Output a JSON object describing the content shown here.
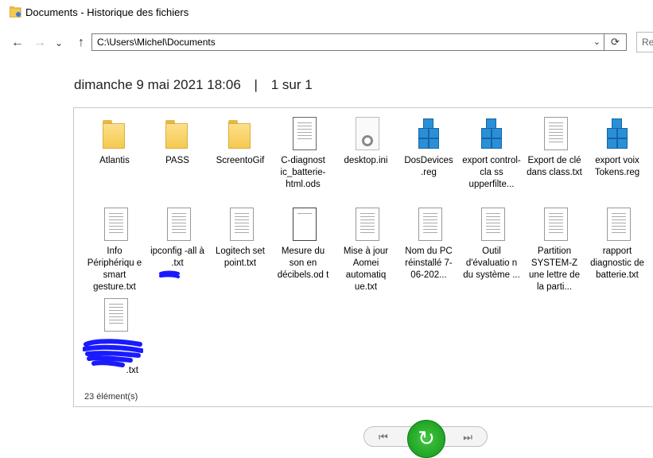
{
  "window": {
    "title": "Documents - Historique des fichiers"
  },
  "nav": {
    "back_icon": "arrow-left-icon",
    "forward_icon": "arrow-right-icon",
    "recent_icon": "chevron-down-icon",
    "up_icon": "arrow-up-icon",
    "back_glyph": "←",
    "forward_glyph": "→",
    "recent_glyph": "⌄",
    "up_glyph": "↑",
    "address": "C:\\Users\\Michel\\Documents",
    "dropdown_glyph": "⌄",
    "refresh_glyph": "⟳",
    "search_placeholder": "Re"
  },
  "header": {
    "date": "dimanche 9 mai 2021 18:06",
    "separator": "|",
    "page_info": "1 sur 1"
  },
  "items": [
    {
      "name": "Atlantis",
      "type": "folder"
    },
    {
      "name": "PASS",
      "type": "folder"
    },
    {
      "name": "ScreentoGif",
      "type": "folder"
    },
    {
      "name": "C-diagnostic_batterie-html.ods",
      "display": "C-diagnost ic_batterie- html.ods",
      "type": "ods"
    },
    {
      "name": "desktop.ini",
      "type": "ini"
    },
    {
      "name": "DosDevices.reg",
      "display": "DosDevices .reg",
      "type": "reg"
    },
    {
      "name": "export control-class upperfilte...",
      "display": "export control-cla ss upperfilte...",
      "type": "reg"
    },
    {
      "name": "Export de clé dans class.txt",
      "display": "Export de clé dans class.txt",
      "type": "txt"
    },
    {
      "name": "export voix Tokens.reg",
      "display": "export voix Tokens.reg",
      "type": "reg"
    },
    {
      "name": "Info Périphérique smart gesture.txt",
      "display": "Info Périphériqu e smart gesture.txt",
      "type": "txt"
    },
    {
      "name": "ipconfig-all à .txt",
      "display": "ipconfig -all à .txt",
      "type": "txt"
    },
    {
      "name": "Logitech set point.txt",
      "display": "Logitech set point.txt",
      "type": "txt"
    },
    {
      "name": "Mesure du son en décibels.odt",
      "display": "Mesure du son en décibels.od t",
      "type": "odt"
    },
    {
      "name": "Mise à jour Aomei automatique.txt",
      "display": "Mise à jour Aomei automatiq ue.txt",
      "type": "txt"
    },
    {
      "name": "Nom du PC réinstallé 7-06-202...",
      "display": "Nom du PC réinstallé 7-06-202...",
      "type": "txt"
    },
    {
      "name": "Outil d'évaluation du système ...",
      "display": "Outil d'évaluatio n du système ...",
      "type": "txt"
    },
    {
      "name": "Partition SYSTEM-Z une lettre de la parti...",
      "display": "Partition SYSTEM-Z une lettre de la parti...",
      "type": "txt"
    },
    {
      "name": "rapport diagnostic de batterie.txt",
      "display": "rapport diagnostic de batterie.txt",
      "type": "txt"
    },
    {
      "name": ".txt",
      "display": ".txt",
      "type": "txt"
    }
  ],
  "status": {
    "count": "23 élément(s)"
  },
  "bottom": {
    "prev_icon": "skip-previous-icon",
    "next_icon": "skip-next-icon",
    "restore_icon": "restore-icon",
    "prev_glyph": "⏮",
    "next_glyph": "⏭",
    "restore_glyph": "↻"
  }
}
